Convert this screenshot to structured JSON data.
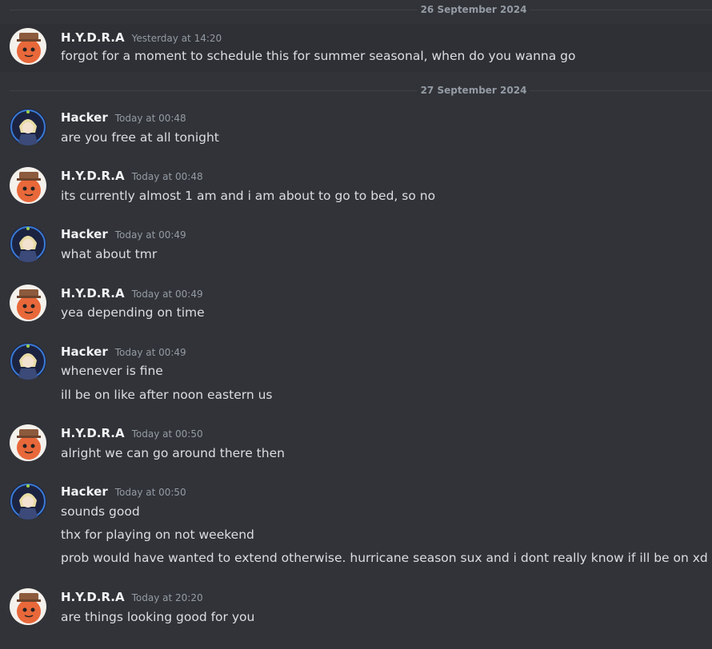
{
  "dividers": [
    "26 September 2024",
    "27 September 2024"
  ],
  "users": {
    "hydra": "H.Y.D.R.A",
    "hacker": "Hacker"
  },
  "messages": [
    {
      "user": "H.Y.D.R.A",
      "time": "Yesterday at 14:20",
      "lines": [
        "forgot for a moment to schedule this for summer seasonal, when do you wanna go"
      ]
    },
    {
      "user": "Hacker",
      "time": "Today at 00:48",
      "lines": [
        "are you free at all tonight"
      ]
    },
    {
      "user": "H.Y.D.R.A",
      "time": "Today at 00:48",
      "lines": [
        "its currently almost 1 am and i am about to go to bed, so no"
      ]
    },
    {
      "user": "Hacker",
      "time": "Today at 00:49",
      "lines": [
        "what about tmr"
      ]
    },
    {
      "user": "H.Y.D.R.A",
      "time": "Today at 00:49",
      "lines": [
        "yea depending on time"
      ]
    },
    {
      "user": "Hacker",
      "time": "Today at 00:49",
      "lines": [
        "whenever is fine",
        "ill be on like after noon eastern us"
      ]
    },
    {
      "user": "H.Y.D.R.A",
      "time": "Today at 00:50",
      "lines": [
        "alright we can go around there then"
      ]
    },
    {
      "user": "Hacker",
      "time": "Today at 00:50",
      "lines": [
        "sounds good",
        "thx for playing on not weekend",
        "prob would have wanted to extend otherwise. hurricane season sux and i dont really know if ill be on xd"
      ]
    },
    {
      "user": "H.Y.D.R.A",
      "time": "Today at 20:20",
      "lines": [
        "are things looking good for you"
      ]
    }
  ],
  "icons": {
    "hydra_avatar": "orange-creature-avatar",
    "hacker_avatar": "anime-character-avatar"
  }
}
